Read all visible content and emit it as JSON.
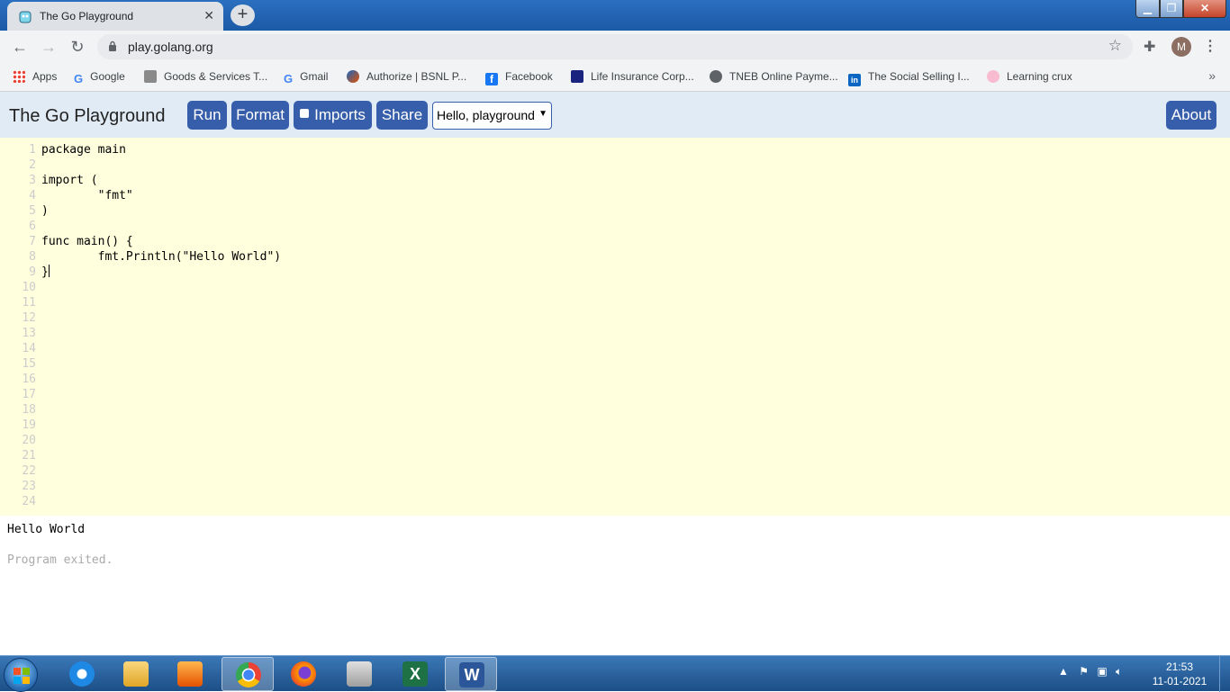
{
  "browser": {
    "tab_title": "The Go Playground",
    "tab_close": "✕",
    "new_tab": "+",
    "url": "play.golang.org",
    "avatar_initial": "M"
  },
  "bookmarks": [
    {
      "label": "Apps",
      "icon": "apps-grid-icon",
      "color": "#4285f4"
    },
    {
      "label": "Google",
      "icon": "google-icon",
      "color": "#4285f4"
    },
    {
      "label": "Goods & Services T...",
      "icon": "gst-emblem-icon",
      "color": "#6d6d6d"
    },
    {
      "label": "Gmail",
      "icon": "google-icon",
      "color": "#ea4335"
    },
    {
      "label": "Authorize | BSNL P...",
      "icon": "bsnl-icon",
      "color": "#e65100"
    },
    {
      "label": "Facebook",
      "icon": "facebook-icon",
      "color": "#1877f2"
    },
    {
      "label": "Life Insurance Corp...",
      "icon": "lic-icon",
      "color": "#1a237e"
    },
    {
      "label": "TNEB Online Payme...",
      "icon": "globe-icon",
      "color": "#5f6368"
    },
    {
      "label": "The Social Selling I...",
      "icon": "linkedin-icon",
      "color": "#0a66c2"
    },
    {
      "label": "Learning crux",
      "icon": "learning-crux-icon",
      "color": "#c2185b"
    }
  ],
  "playground": {
    "title": "The Go Playground",
    "run_label": "Run",
    "format_label": "Format",
    "imports_label": "Imports",
    "share_label": "Share",
    "about_label": "About",
    "example_selected": "Hello, playground",
    "accent_color": "#375eab"
  },
  "editor": {
    "line_numbers": [
      "1",
      "2",
      "3",
      "4",
      "5",
      "6",
      "7",
      "8",
      "9",
      "10",
      "11",
      "12",
      "13",
      "14",
      "15",
      "16",
      "17",
      "18",
      "19",
      "20",
      "21",
      "22",
      "23",
      "24"
    ],
    "code_lines": [
      "package main",
      "",
      "import (",
      "        \"fmt\"",
      ")",
      "",
      "func main() {",
      "        fmt.Println(\"Hello World\")",
      "}"
    ]
  },
  "output": {
    "stdout": "Hello World",
    "system": "Program exited."
  },
  "taskbar": {
    "apps": [
      "internet-explorer-icon",
      "file-explorer-icon",
      "media-player-icon",
      "chrome-icon",
      "firefox-icon",
      "calculator-icon",
      "excel-icon",
      "word-icon"
    ],
    "time": "21:53",
    "date": "11-01-2021"
  }
}
